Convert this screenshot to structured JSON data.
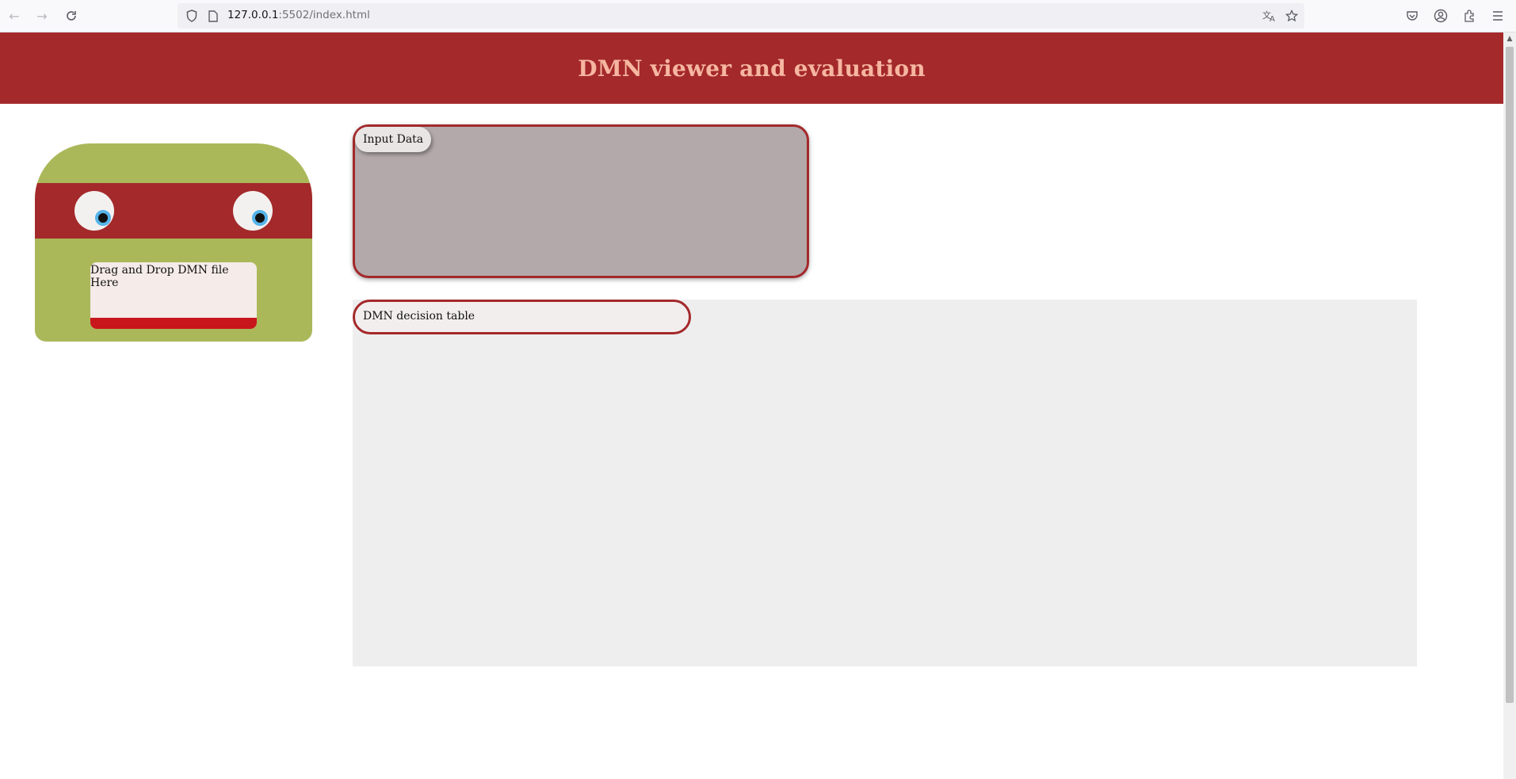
{
  "browser": {
    "url_host": "127.0.0.1",
    "url_rest": ":5502/index.html"
  },
  "header": {
    "title": "DMN viewer and evaluation",
    "background": "#a4292b",
    "title_color": "#f6b6a0"
  },
  "dropzone": {
    "label": "Drag and Drop DMN file Here",
    "body_color": "#abb85a",
    "bandana_color": "#a4292b",
    "eye_iris_color": "#56b4e9"
  },
  "input_panel": {
    "label": "Input Data",
    "background": "#b3a9aa"
  },
  "decision_table": {
    "label": "DMN decision table"
  }
}
